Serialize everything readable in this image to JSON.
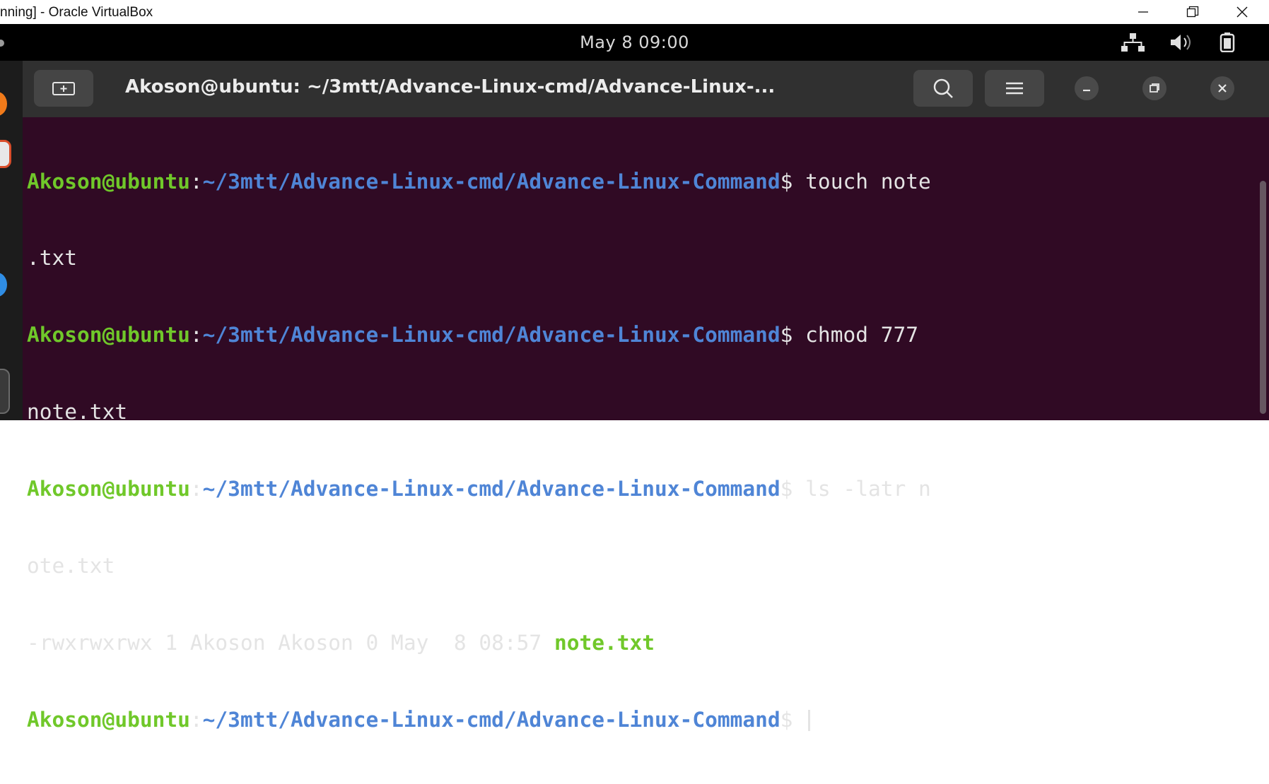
{
  "host_window": {
    "title": "nning] - Oracle VirtualBox",
    "controls": [
      "minimize-icon",
      "restore-icon",
      "close-icon"
    ]
  },
  "ubuntu_topbar": {
    "clock": "May 8  09:00",
    "tray_icons": [
      "network-icon",
      "volume-icon",
      "battery-icon"
    ]
  },
  "dock": {
    "items": [
      "firefox-icon",
      "files-icon",
      "thunderbird-icon",
      "apps-icon"
    ]
  },
  "terminal": {
    "title": "Akoson@ubuntu: ~/3mtt/Advance-Linux-cmd/Advance-Linux-...",
    "buttons": [
      "new-tab-icon",
      "search-icon",
      "hamburger-menu-icon",
      "minimize-icon",
      "maximize-icon",
      "close-icon"
    ],
    "colors": {
      "background": "#300a24",
      "user": "#70c82a",
      "path": "#4f85d6",
      "text": "#e4e4e4"
    },
    "lines": [
      {
        "user": "Akoson@ubuntu",
        "colon": ":",
        "path": "~/3mtt/Advance-Linux-cmd/Advance-Linux-Command",
        "dollar": "$",
        "cmd": " touch note"
      },
      {
        "plain": ".txt"
      },
      {
        "user": "Akoson@ubuntu",
        "colon": ":",
        "path": "~/3mtt/Advance-Linux-cmd/Advance-Linux-Command",
        "dollar": "$",
        "cmd": " chmod 777 "
      },
      {
        "plain": "note.txt"
      },
      {
        "user": "Akoson@ubuntu",
        "colon": ":",
        "path": "~/3mtt/Advance-Linux-cmd/Advance-Linux-Command",
        "dollar": "$",
        "cmd": " ls -latr n"
      },
      {
        "plain": "ote.txt"
      },
      {
        "plain": "-rwxrwxrwx 1 Akoson Akoson 0 May  8 08:57 ",
        "file": "note.txt"
      },
      {
        "user": "Akoson@ubuntu",
        "colon": ":",
        "path": "~/3mtt/Advance-Linux-cmd/Advance-Linux-Command",
        "dollar": "$",
        "cmd": " ",
        "cursor": true
      }
    ]
  }
}
